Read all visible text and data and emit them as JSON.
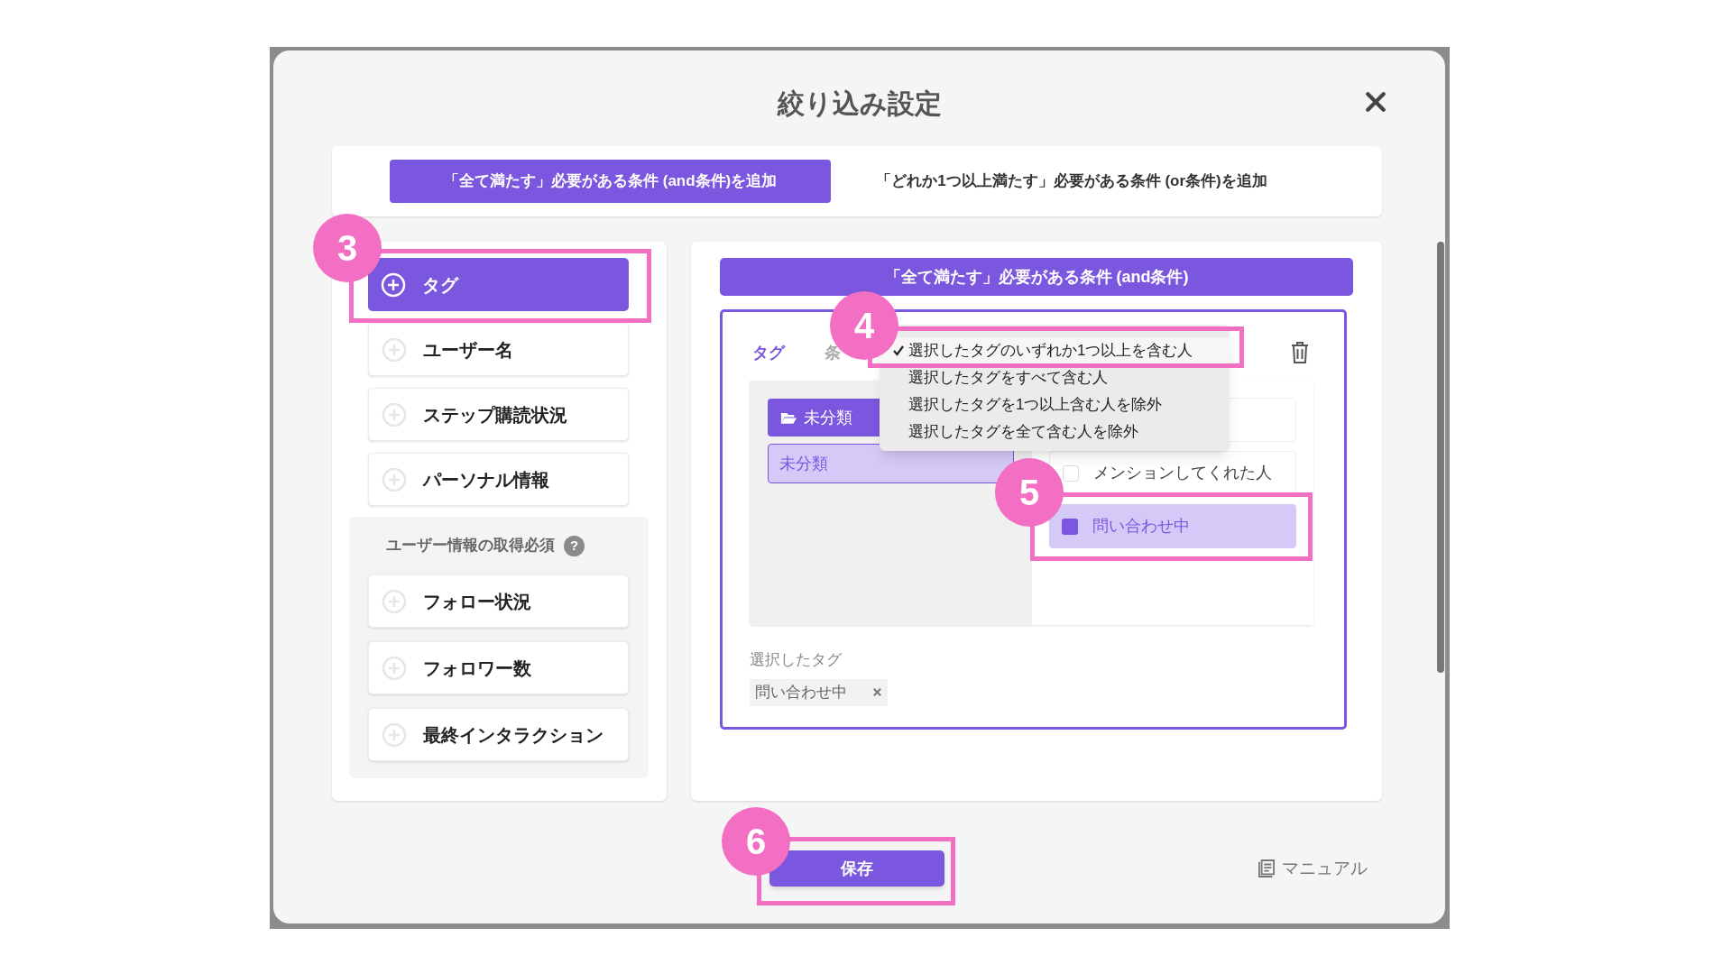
{
  "dialog": {
    "title": "絞り込み設定"
  },
  "mode_tabs": [
    {
      "label": "「全て満たす」必要がある条件 (and条件)を追加",
      "selected": true
    },
    {
      "label": "「どれか1つ以上満たす」必要がある条件 (or条件)を追加",
      "selected": false
    }
  ],
  "categories": [
    {
      "label": "タグ",
      "selected": true
    },
    {
      "label": "ユーザー名",
      "selected": false
    },
    {
      "label": "ステップ購読状況",
      "selected": false
    },
    {
      "label": "パーソナル情報",
      "selected": false
    }
  ],
  "required_group": {
    "title": "ユーザー情報の取得必須",
    "help": "?",
    "items": [
      {
        "label": "フォロー状況",
        "selected": false
      },
      {
        "label": "フォロワー数",
        "selected": false
      },
      {
        "label": "最終インタラクション",
        "selected": false
      }
    ]
  },
  "condition": {
    "header": "「全て満たす」必要がある条件 (and条件)",
    "field_label": "タグ",
    "column_label": "条",
    "menu": [
      {
        "label": "選択したタグのいずれか1つ以上を含む人",
        "selected": true
      },
      {
        "label": "選択したタグをすべて含む人",
        "selected": false
      },
      {
        "label": "選択したタグを1つ以上含む人を除外",
        "selected": false
      },
      {
        "label": "選択したタグを全て含む人を除外",
        "selected": false
      }
    ],
    "folder_button": "未分類",
    "folders": [
      {
        "label": "未分類",
        "selected": true
      }
    ],
    "tags": [
      {
        "label": "メンションしてくれた人",
        "checked": false
      },
      {
        "label": "問い合わせ中",
        "checked": true
      }
    ],
    "selected_label": "選択したタグ",
    "chips": [
      {
        "label": "問い合わせ中"
      }
    ]
  },
  "save": "保存",
  "manual": "マニュアル",
  "annotations": [
    {
      "number": "3"
    },
    {
      "number": "4"
    },
    {
      "number": "5"
    },
    {
      "number": "6"
    }
  ]
}
